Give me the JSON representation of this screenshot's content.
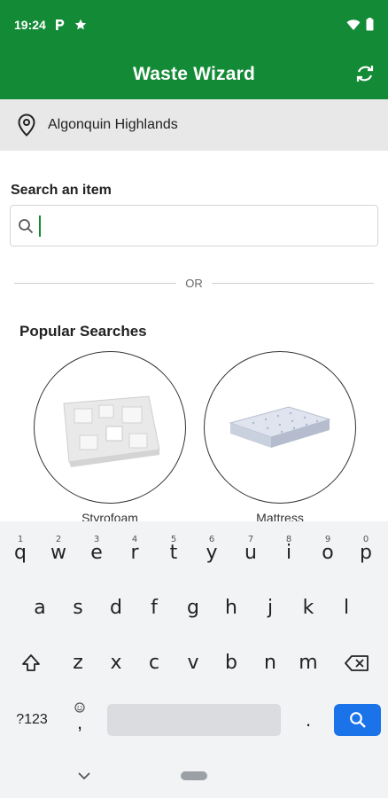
{
  "status": {
    "time": "19:24",
    "notif_icons": [
      "parking-icon",
      "star-icon"
    ]
  },
  "app": {
    "title": "Waste Wizard",
    "accent": "#138a36"
  },
  "location": {
    "name": "Algonquin Highlands"
  },
  "search": {
    "label": "Search an item",
    "value": "",
    "placeholder": ""
  },
  "divider": {
    "text": "OR"
  },
  "popular": {
    "title": "Popular Searches",
    "items": [
      {
        "label": "Styrofoam"
      },
      {
        "label": "Mattress"
      }
    ]
  },
  "keyboard": {
    "row1": [
      {
        "k": "q",
        "n": "1"
      },
      {
        "k": "w",
        "n": "2"
      },
      {
        "k": "e",
        "n": "3"
      },
      {
        "k": "r",
        "n": "4"
      },
      {
        "k": "t",
        "n": "5"
      },
      {
        "k": "y",
        "n": "6"
      },
      {
        "k": "u",
        "n": "7"
      },
      {
        "k": "i",
        "n": "8"
      },
      {
        "k": "o",
        "n": "9"
      },
      {
        "k": "p",
        "n": "0"
      }
    ],
    "row2": [
      "a",
      "s",
      "d",
      "f",
      "g",
      "h",
      "j",
      "k",
      "l"
    ],
    "row3": [
      "z",
      "x",
      "c",
      "v",
      "b",
      "n",
      "m"
    ],
    "symbols_label": "?123",
    "comma": ",",
    "period": "."
  }
}
